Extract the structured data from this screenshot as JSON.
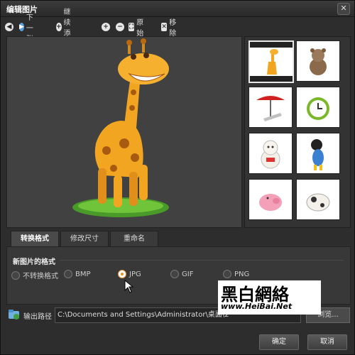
{
  "window": {
    "title": "编辑图片",
    "close_icon": "close-icon",
    "close_glyph": "✕"
  },
  "toolbar": {
    "prev_icon": "arrow-left-icon",
    "next_label": "下一张",
    "add_label": "继续添加",
    "zoom_in_icon": "zoom-in-icon",
    "zoom_out_icon": "zoom-out-icon",
    "original_label": "原始",
    "remove_label": "移除"
  },
  "thumbnails": [
    {
      "icon": "giraffe-icon",
      "selected": true
    },
    {
      "icon": "teddy-bear-icon",
      "selected": false
    },
    {
      "icon": "beach-chair-umbrella-icon",
      "selected": false
    },
    {
      "icon": "alarm-clock-icon",
      "selected": false
    },
    {
      "icon": "lucky-cat-icon",
      "selected": false
    },
    {
      "icon": "cartoon-dog-icon",
      "selected": false
    },
    {
      "icon": "pig-icon",
      "selected": false
    },
    {
      "icon": "cow-icon",
      "selected": false
    }
  ],
  "tabs": [
    {
      "label": "转换格式",
      "active": true
    },
    {
      "label": "修改尺寸",
      "active": false
    },
    {
      "label": "重命名",
      "active": false
    }
  ],
  "format": {
    "section_label": "新图片的格式",
    "options": [
      {
        "label": "不转换格式",
        "checked": false
      },
      {
        "label": "BMP",
        "checked": false
      },
      {
        "label": "JPG",
        "checked": true
      },
      {
        "label": "GIF",
        "checked": false
      },
      {
        "label": "PNG",
        "checked": false
      }
    ]
  },
  "output": {
    "label": "输出路径",
    "path": "C:\\Documents and Settings\\Administrator\\桌面\\2",
    "browse_label": "浏览..."
  },
  "buttons": {
    "ok": "确定",
    "cancel": "取消"
  },
  "watermark": {
    "line1": "黑白網絡",
    "line2": "www.HeiBai.Net"
  },
  "colors": {
    "accent": "#e8902a",
    "window_bg": "#2d2d2d"
  }
}
